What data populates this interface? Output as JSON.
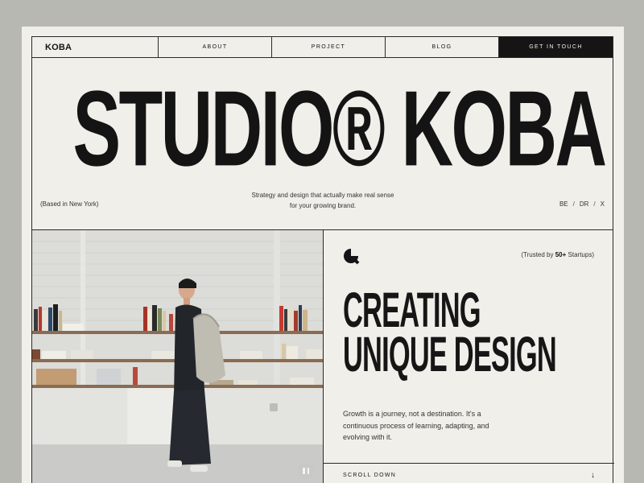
{
  "nav": {
    "logo": "KOBA",
    "links": [
      "ABOUT",
      "PROJECT",
      "BLOG"
    ],
    "cta": "GET IN TOUCH"
  },
  "hero": {
    "title": "STUDIO® KOBA",
    "based": "(Based in New York)",
    "tagline_line1": "Strategy and design that actually make real sense",
    "tagline_line2": "for your growing brand.",
    "social": [
      "BE",
      "DR",
      "X"
    ],
    "social_sep": "/"
  },
  "right": {
    "trusted_prefix": "(Trusted by ",
    "trusted_bold": "50+",
    "trusted_suffix": " Startups)",
    "headline_line1": "CREATING",
    "headline_line2": "UNIQUE DESIGN",
    "desc": "Growth is a journey, not a destination. It's a continuous process of learning, adapting, and evolving with it.",
    "scroll": "SCROLL DOWN",
    "scroll_icon": "arrow-down-icon",
    "scroll_glyph": "↓"
  },
  "media": {
    "pause_icon": "pause-icon"
  },
  "colors": {
    "background": "#b8b8b3",
    "page": "#f1efea",
    "ink": "#151515"
  }
}
